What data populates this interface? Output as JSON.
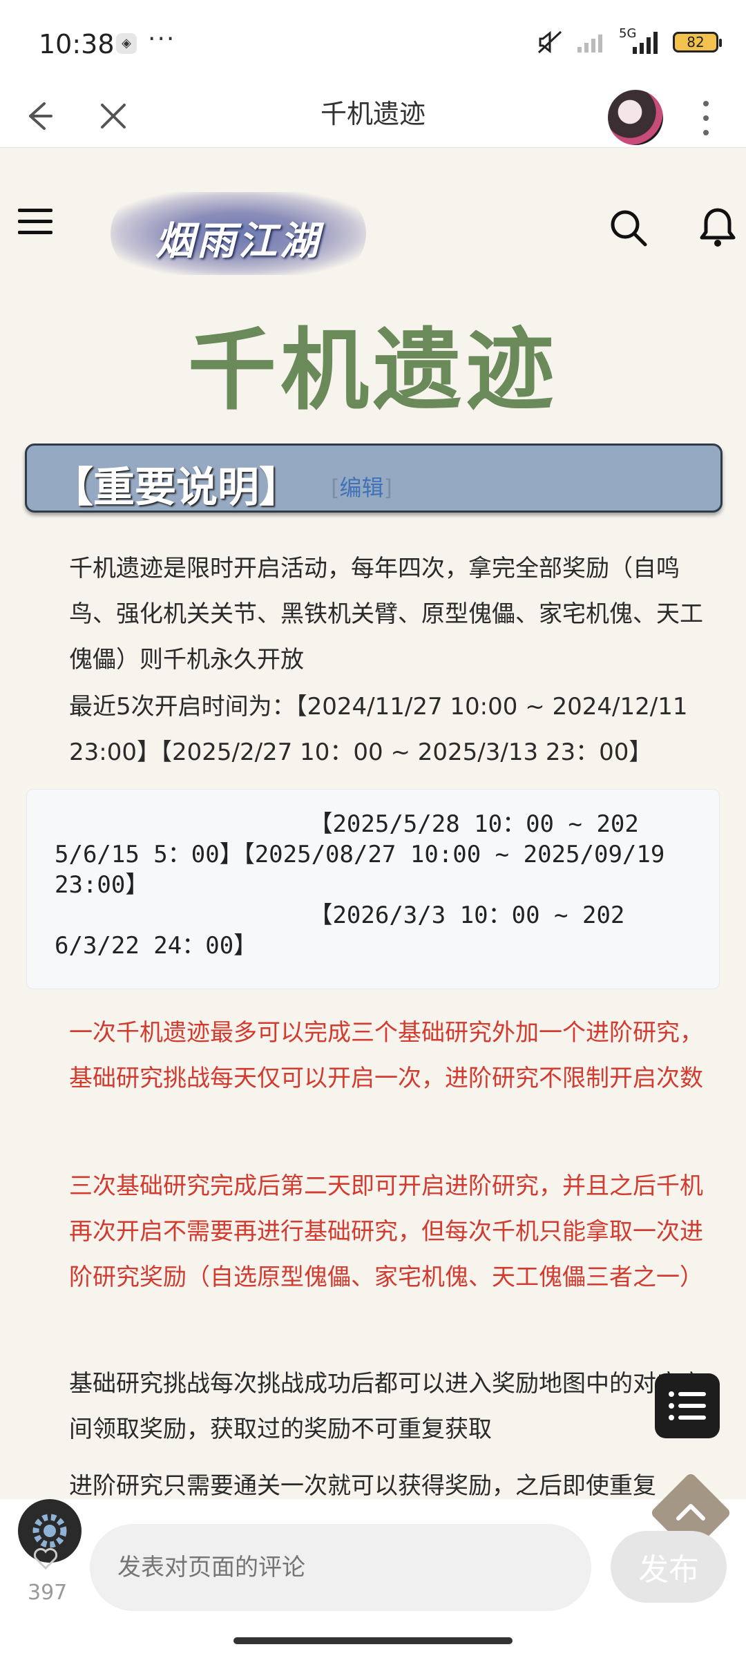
{
  "status_bar": {
    "time": "10:38",
    "app_icon": "app-notification-icon",
    "battery": "82",
    "network": "5G"
  },
  "app_bar": {
    "title": "千机遗迹"
  },
  "site": {
    "logo_text": "烟雨江湖"
  },
  "page": {
    "title": "千机遗迹",
    "section_title": "【重要说明】",
    "edit_link": {
      "open": "[",
      "label": "编辑",
      "close": "]"
    },
    "para1": "千机遗迹是限时开启活动，每年四次，拿完全部奖励（自鸣鸟、强化机关关节、黑铁机关臂、原型傀儡、家宅机傀、天工傀儡）则千机永久开放",
    "para2": "最近5次开启时间为：【2024/11/27 10:00 ~ 2024/12/11 23:00】【2025/2/27 10：00 ~ 2025/3/13 23：00】",
    "code_block": "                  【2025/5/28 10：00 ~ 202\n5/6/15 5：00】【2025/08/27 10:00 ~ 2025/09/19\n23:00】\n                  【2026/3/3 10：00 ~ 202\n6/3/22 24：00】",
    "red1": "一次千机遗迹最多可以完成三个基础研究外加一个进阶研究，基础研究挑战每天仅可以开启一次，进阶研究不限制开启次数",
    "red2": "三次基础研究完成后第二天即可开启进阶研究，并且之后千机再次开启不需要再进行基础研究，但每次千机只能拿取一次进阶研究奖励（自选原型傀儡、家宅机傀、天工傀儡三者之一）",
    "para3": "基础研究挑战每次挑战成功后都可以进入奖励地图中的对应房间领取奖励，获取过的奖励不可重复获取",
    "para4": "进阶研究只需要通关一次就可以获得奖励，之后即使重复"
  },
  "bottom": {
    "like_count": "397",
    "comment_placeholder": "发表对页面的评论",
    "publish_label": "发布"
  },
  "colors": {
    "title_green": "#6a8a59",
    "section_bg": "#95a9c2",
    "red_text": "#d23b2f"
  }
}
